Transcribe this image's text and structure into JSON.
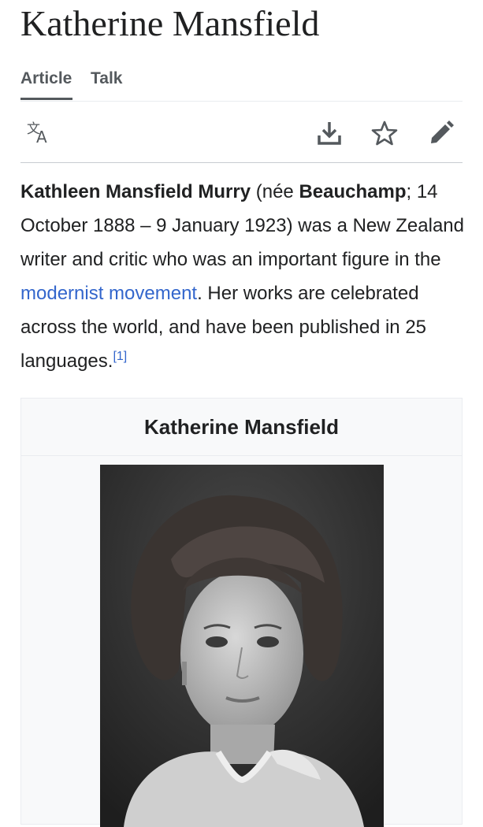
{
  "page": {
    "title": "Katherine Mansfield"
  },
  "tabs": [
    {
      "label": "Article",
      "active": true
    },
    {
      "label": "Talk",
      "active": false
    }
  ],
  "toolbar": {
    "icons": [
      "language-icon",
      "download-icon",
      "star-icon",
      "edit-pencil-icon"
    ]
  },
  "lead": {
    "name_bold": "Kathleen Mansfield Murry",
    "born_prefix": " (née ",
    "birth_name_bold": "Beauchamp",
    "dates_text": "; 14 October 1888 – 9 January 1923) was a New Zealand writer and critic who was an important figure in the ",
    "link_text": "modernist movement",
    "closing_text": ". Her works are celebrated across the world, and have been published in 25 languages.",
    "citation": "[1]"
  },
  "infobox": {
    "title": "Katherine Mansfield",
    "image_alt": "Portrait photograph of Katherine Mansfield"
  },
  "colors": {
    "text": "#202122",
    "link": "#3366cc",
    "muted": "#54595d",
    "infobox_bg": "#f8f9fa",
    "border": "#eaecf0"
  }
}
